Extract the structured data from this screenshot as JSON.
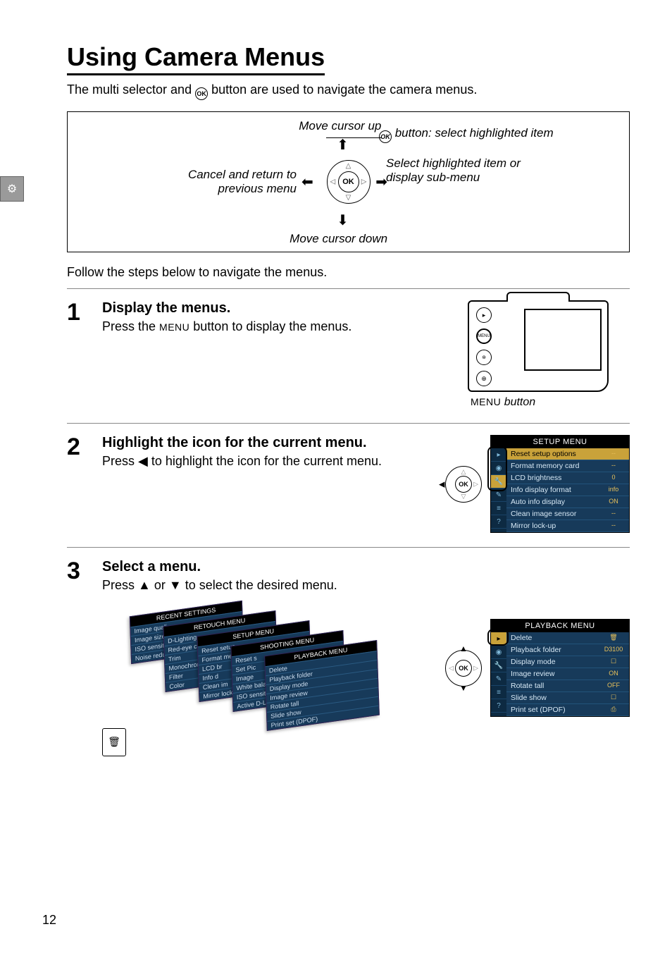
{
  "page": {
    "number": "12",
    "title": "Using Camera Menus",
    "intro_pre": "The multi selector and ",
    "intro_post": " button are used to navigate the camera menus.",
    "follow": "Follow the steps below to navigate the menus."
  },
  "diagram": {
    "up": "Move cursor up",
    "down": "Move cursor down",
    "left": "Cancel and return to previous menu",
    "right": "Select highlighted item or display sub-menu",
    "ok": " button: select highlighted item",
    "ok_label": "OK"
  },
  "steps": [
    {
      "num": "1",
      "title": "Display the menus.",
      "text_pre": "Press the ",
      "text_mid": "MENU",
      "text_post": " button to display the menus.",
      "caption_pre": "MENU",
      "caption_post": " button"
    },
    {
      "num": "2",
      "title": "Highlight the icon for the current menu.",
      "text_pre": "Press ",
      "text_glyph": "◀",
      "text_post": " to highlight the icon for the current menu.",
      "lcd_title": "SETUP MENU",
      "rows": [
        {
          "label": "Reset setup options",
          "val": "--"
        },
        {
          "label": "Format memory card",
          "val": "--"
        },
        {
          "label": "LCD brightness",
          "val": "0"
        },
        {
          "label": "Info display format",
          "val": "info"
        },
        {
          "label": "Auto info display",
          "val": "ON"
        },
        {
          "label": "Clean image sensor",
          "val": "--"
        },
        {
          "label": "Mirror lock-up",
          "val": "--"
        }
      ]
    },
    {
      "num": "3",
      "title": "Select a menu.",
      "text_pre": "Press ",
      "text_glyph1": "▲",
      "text_mid": " or ",
      "text_glyph2": "▼",
      "text_post": " to select the desired menu.",
      "lcd_title": "PLAYBACK MENU",
      "rows": [
        {
          "label": "Delete",
          "val": "🗑"
        },
        {
          "label": "Playback folder",
          "val": "D3100"
        },
        {
          "label": "Display mode",
          "val": "☐"
        },
        {
          "label": "Image review",
          "val": "ON"
        },
        {
          "label": "Rotate tall",
          "val": "OFF"
        },
        {
          "label": "Slide show",
          "val": "☐"
        },
        {
          "label": "Print set (DPOF)",
          "val": "⎙"
        }
      ]
    }
  ],
  "stack": {
    "cards": [
      {
        "title": "RECENT SETTINGS",
        "rows": [
          "Image quali",
          "Image size",
          "ISO sensitiv",
          "Noise reduc"
        ]
      },
      {
        "title": "RETOUCH MENU",
        "rows": [
          "D-Lighting",
          "Red-eye co",
          "Trim",
          "Monochrom",
          "Filter",
          "Color"
        ]
      },
      {
        "title": "SETUP MENU",
        "rows": [
          "Reset setup",
          "Format mem",
          "LCD br",
          "Info d",
          "Clean im",
          "Mirror lock"
        ]
      },
      {
        "title": "SHOOTING MENU",
        "rows": [
          "Reset s",
          "Set Pic",
          "Image",
          "White bala",
          "ISO sensitiv",
          "Active D-Lig"
        ]
      },
      {
        "title": "PLAYBACK MENU",
        "rows": [
          "Delete",
          "Playback folder",
          "Display mode",
          "Image review",
          "Rotate tall",
          "Slide show",
          "Print set (DPOF)"
        ]
      }
    ]
  },
  "icons": {
    "side_tab": "⚙",
    "ok": "OK",
    "play": "▸",
    "menu": "MENU"
  }
}
